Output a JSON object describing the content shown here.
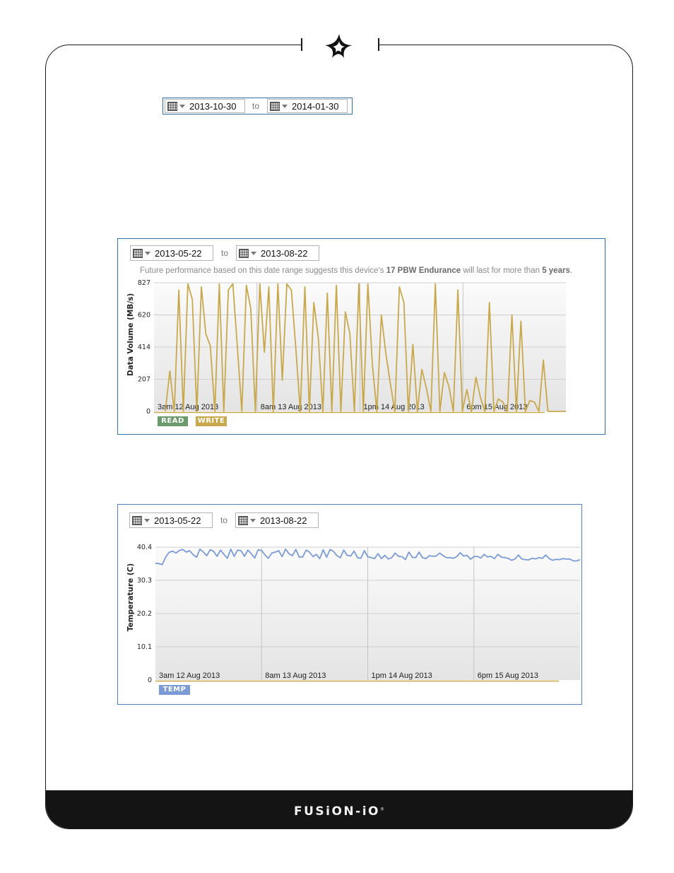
{
  "header": {
    "top_date_range": {
      "from": "2013-10-30",
      "to_label": "to",
      "to": "2014-01-30"
    }
  },
  "panels": [
    {
      "id": "data-volume",
      "date_range": {
        "from": "2013-05-22",
        "to_label": "to",
        "to": "2013-08-22"
      },
      "note": {
        "prefix": "Future performance based on this date range suggests this device's ",
        "endurance": "17 PBW Endurance",
        "middle": " will last for more than ",
        "years": "5 years",
        "suffix": "."
      },
      "legend": [
        {
          "label": "READ",
          "color": "#6b9a6b"
        },
        {
          "label": "WRITE",
          "color": "#c9a84c"
        }
      ]
    },
    {
      "id": "temperature",
      "date_range": {
        "from": "2013-05-22",
        "to_label": "to",
        "to": "2013-08-22"
      },
      "legend": [
        {
          "label": "TEMP",
          "color": "#7b9bd6"
        }
      ]
    }
  ],
  "chart_data": [
    {
      "type": "line",
      "title": "",
      "xlabel": "",
      "ylabel": "Data Volume (MB/s)",
      "ylim": [
        0,
        827
      ],
      "yticks": [
        "0",
        "207",
        "414",
        "620",
        "827"
      ],
      "xticks": [
        "3am 12 Aug 2013",
        "8am 13 Aug 2013",
        "1pm 14 Aug 2013",
        "6pm 15 Aug 2013"
      ],
      "grid": true,
      "series": [
        {
          "name": "WRITE",
          "color": "#c9a84c",
          "values": [
            0,
            260,
            0,
            780,
            0,
            820,
            720,
            0,
            800,
            500,
            420,
            0,
            820,
            0,
            780,
            820,
            420,
            0,
            810,
            660,
            0,
            820,
            380,
            800,
            0,
            820,
            200,
            820,
            780,
            400,
            0,
            800,
            0,
            700,
            470,
            0,
            760,
            0,
            810,
            0,
            640,
            500,
            0,
            820,
            0,
            820,
            300,
            0,
            620,
            370,
            180,
            0,
            800,
            700,
            0,
            430,
            0,
            270,
            150,
            0,
            820,
            0,
            250,
            160,
            0,
            780,
            0,
            140,
            0,
            220,
            90,
            0,
            700,
            0,
            80,
            60,
            0,
            620,
            0,
            580,
            0,
            70,
            60,
            0,
            330,
            0,
            0,
            0,
            0,
            0
          ]
        },
        {
          "name": "READ",
          "color": "#6b9a6b",
          "values": [
            0,
            0,
            0,
            0,
            0,
            0,
            0,
            0,
            0,
            0,
            0,
            0,
            0,
            0,
            0,
            0,
            0,
            0,
            0,
            0,
            0,
            0,
            0,
            0,
            0,
            0,
            0,
            0,
            0,
            0,
            0,
            0,
            0,
            0,
            0,
            0,
            0,
            0,
            0,
            0,
            0,
            0,
            0,
            0,
            0,
            0,
            0,
            0,
            0,
            0,
            0,
            0,
            0,
            0,
            0,
            0,
            0,
            0,
            0,
            0,
            0,
            0,
            0,
            0,
            0,
            0,
            0,
            0,
            0,
            0,
            0,
            0,
            0,
            0,
            0,
            0,
            0,
            0,
            0,
            0,
            0,
            0,
            0,
            0,
            0,
            0,
            0,
            0,
            0,
            0
          ]
        }
      ]
    },
    {
      "type": "line",
      "title": "",
      "xlabel": "",
      "ylabel": "Temperature (C)",
      "ylim": [
        0,
        40.4
      ],
      "yticks": [
        "0",
        "10.1",
        "20.2",
        "30.3",
        "40.4"
      ],
      "xticks": [
        "3am 12 Aug 2013",
        "8am 13 Aug 2013",
        "1pm 14 Aug 2013",
        "6pm 15 Aug 2013"
      ],
      "grid": true,
      "series": [
        {
          "name": "TEMP",
          "color": "#7b9bd6",
          "values": [
            35.5,
            35.4,
            35.1,
            37.4,
            38.8,
            39.2,
            38.6,
            39.4,
            39.7,
            38.9,
            39.3,
            38.1,
            37.3,
            39.8,
            38.9,
            37.8,
            39.6,
            39.1,
            37.6,
            39.5,
            38.2,
            37.0,
            39.8,
            37.6,
            39.5,
            39.3,
            37.6,
            39.5,
            38.4,
            37.1,
            39.6,
            39.4,
            38.0,
            37.0,
            38.6,
            38.9,
            39.3,
            37.5,
            39.8,
            38.4,
            37.8,
            39.7,
            37.4,
            37.4,
            39.5,
            38.9,
            37.5,
            38.2,
            36.9,
            39.6,
            37.3,
            39.7,
            39.1,
            37.8,
            37.2,
            39.5,
            37.9,
            37.7,
            39.2,
            37.2,
            37.0,
            39.3,
            37.5,
            37.2,
            36.9,
            38.4,
            36.9,
            37.9,
            36.8,
            37.2,
            38.6,
            37.6,
            37.5,
            36.6,
            38.9,
            37.3,
            37.2,
            38.9,
            37.2,
            36.9,
            37.8,
            37.6,
            37.7,
            38.6,
            37.8,
            37.2,
            37.2,
            37.0,
            37.5,
            38.7,
            37.7,
            37.9,
            36.7,
            37.5,
            37.6,
            37.1,
            38.2,
            37.4,
            37.6,
            36.9,
            38.2,
            37.4,
            37.2,
            37.0,
            36.4,
            36.8,
            38.0,
            36.8,
            36.6,
            36.5,
            37.0,
            36.8,
            37.2,
            37.0,
            38.0,
            36.9,
            36.4,
            36.7,
            36.6,
            36.9,
            36.8,
            36.8,
            36.2,
            36.2,
            36.6
          ]
        }
      ]
    }
  ],
  "footer": {
    "brand": "FUSiON-iO",
    "trademark": "®"
  }
}
